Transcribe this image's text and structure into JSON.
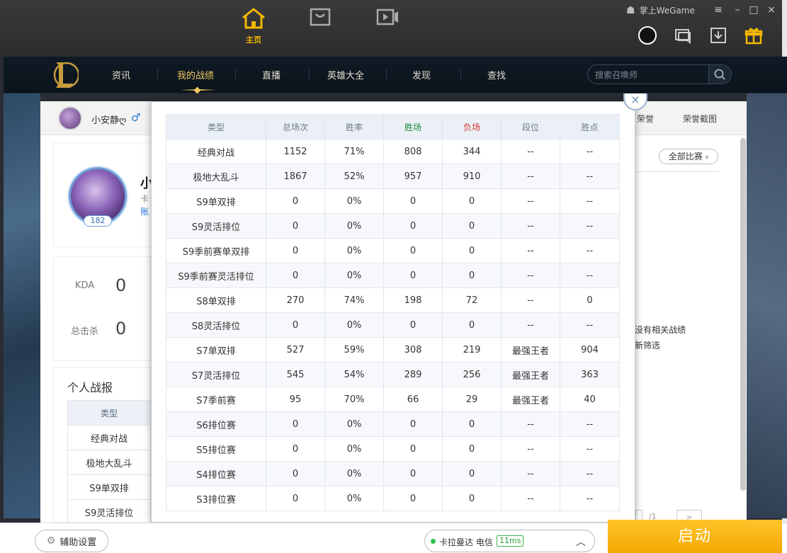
{
  "topnav": {
    "home_label": "主页",
    "brand": "掌上WeGame"
  },
  "lol_nav": [
    "资讯",
    "我的战绩",
    "直播",
    "英雄大全",
    "发现",
    "查找"
  ],
  "search": {
    "placeholder": "搜索召唤师"
  },
  "summoner": {
    "name": "小安静ღ",
    "gender_symbol": "♂",
    "level": "182",
    "name_partial": "小",
    "line1_partial": "卡",
    "line2_partial": "账"
  },
  "subtabs": {
    "honor": "荣誉",
    "honor_screenshot": "荣誉截图"
  },
  "stats": {
    "kda_label": "KDA",
    "kda_value": "0",
    "kills_label": "总击杀",
    "kills_value": "0"
  },
  "report": {
    "title": "个人战报",
    "header": "类型",
    "rows": [
      "经典对战",
      "极地大乱斗",
      "S9单双排",
      "S9灵活排位"
    ]
  },
  "right_panel": {
    "filter_label": "全部比赛",
    "empty_line1": "没有相关战绩",
    "empty_line2": "新筛选",
    "pager_text": "/1",
    "pager_next": ">"
  },
  "table": {
    "headers": [
      "类型",
      "总场次",
      "胜率",
      "胜场",
      "负场",
      "段位",
      "胜点"
    ],
    "rows": [
      [
        "经典对战",
        "1152",
        "71%",
        "808",
        "344",
        "--",
        "--"
      ],
      [
        "极地大乱斗",
        "1867",
        "52%",
        "957",
        "910",
        "--",
        "--"
      ],
      [
        "S9单双排",
        "0",
        "0%",
        "0",
        "0",
        "--",
        "--"
      ],
      [
        "S9灵活排位",
        "0",
        "0%",
        "0",
        "0",
        "--",
        "--"
      ],
      [
        "S9季前赛单双排",
        "0",
        "0%",
        "0",
        "0",
        "--",
        "--"
      ],
      [
        "S9季前赛灵活排位",
        "0",
        "0%",
        "0",
        "0",
        "--",
        "--"
      ],
      [
        "S8单双排",
        "270",
        "74%",
        "198",
        "72",
        "--",
        "0"
      ],
      [
        "S8灵活排位",
        "0",
        "0%",
        "0",
        "0",
        "--",
        "--"
      ],
      [
        "S7单双排",
        "527",
        "59%",
        "308",
        "219",
        "最强王者",
        "904"
      ],
      [
        "S7灵活排位",
        "545",
        "54%",
        "289",
        "256",
        "最强王者",
        "363"
      ],
      [
        "S7季前赛",
        "95",
        "70%",
        "66",
        "29",
        "最强王者",
        "40"
      ],
      [
        "S6排位赛",
        "0",
        "0%",
        "0",
        "0",
        "--",
        "--"
      ],
      [
        "S5排位赛",
        "0",
        "0%",
        "0",
        "0",
        "--",
        "--"
      ],
      [
        "S4排位赛",
        "0",
        "0%",
        "0",
        "0",
        "--",
        "--"
      ],
      [
        "S3排位赛",
        "0",
        "0%",
        "0",
        "0",
        "--",
        "--"
      ]
    ]
  },
  "popup": {
    "close_symbol": "×"
  },
  "bottom": {
    "assist_label": "辅助设置",
    "server_name": "卡拉曼达 电信",
    "ping": "11ms",
    "start_label": "启动"
  },
  "colors": {
    "accent": "#f5b800",
    "win": "#1c8a3a",
    "loss": "#d83a3a",
    "start": "#f5a800"
  }
}
